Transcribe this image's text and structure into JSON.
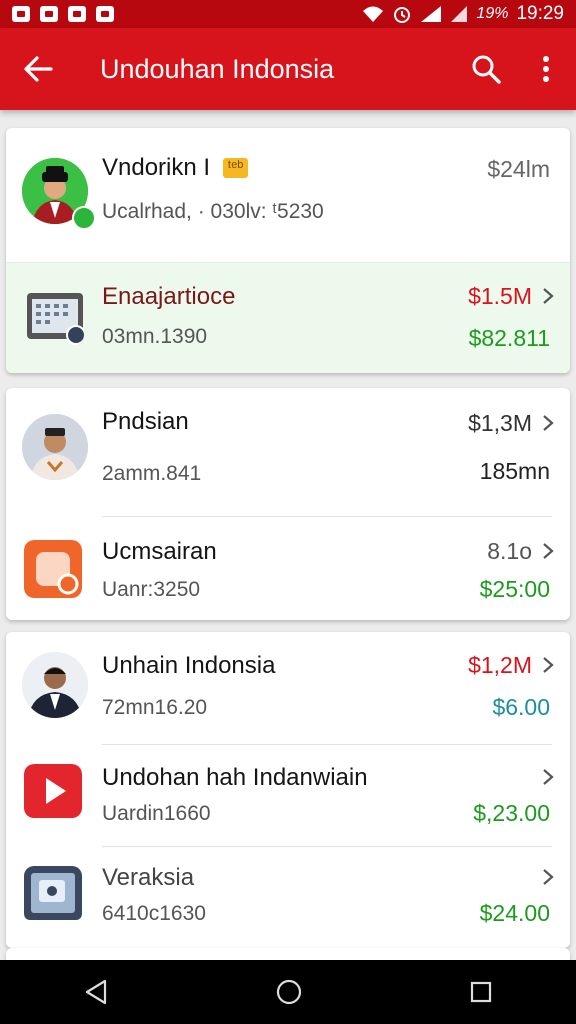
{
  "status_bar": {
    "battery": "19%",
    "time": "19:29"
  },
  "app_bar": {
    "title": "Undouhan Indonsia"
  },
  "card1": {
    "top": {
      "name": "Vndorikn I",
      "badge": "ᵗᵉᵇ",
      "sub": "Ucalrhad, · 030lv: ᵗ5230",
      "amount": "$24lm"
    },
    "bottom": {
      "name": "Enaajartioce",
      "sub": "03mn.1390",
      "amount": "$1.5M",
      "amount2": "$82.811"
    }
  },
  "card2": {
    "top": {
      "name": "Pndsian",
      "sub": "2amm.841",
      "amount": "$1,3M",
      "amount2": "185mn"
    },
    "bottom": {
      "name": "Ucmsairan",
      "sub": "Uanr:3250",
      "amount": "8.1o",
      "amount2": "$25:00"
    }
  },
  "card3": {
    "row1": {
      "name": "Unhain Indonsia",
      "sub": "72mn16.20",
      "amount": "$1,2M",
      "amount2": "$6.00"
    },
    "row2": {
      "name": "Undohan hah Indanwiain",
      "sub": "Uardin1660",
      "amount2": "$,23.00"
    },
    "row3": {
      "name": "Veraksia",
      "sub": "6410c1630",
      "amount2": "$24.00"
    }
  },
  "colors": {
    "red_primary": "#d7141c",
    "green_value": "#1d9b1d",
    "red_value": "#d7141c",
    "teal_value": "#1b8fa0",
    "highlight_bg": "#eef9ee"
  }
}
